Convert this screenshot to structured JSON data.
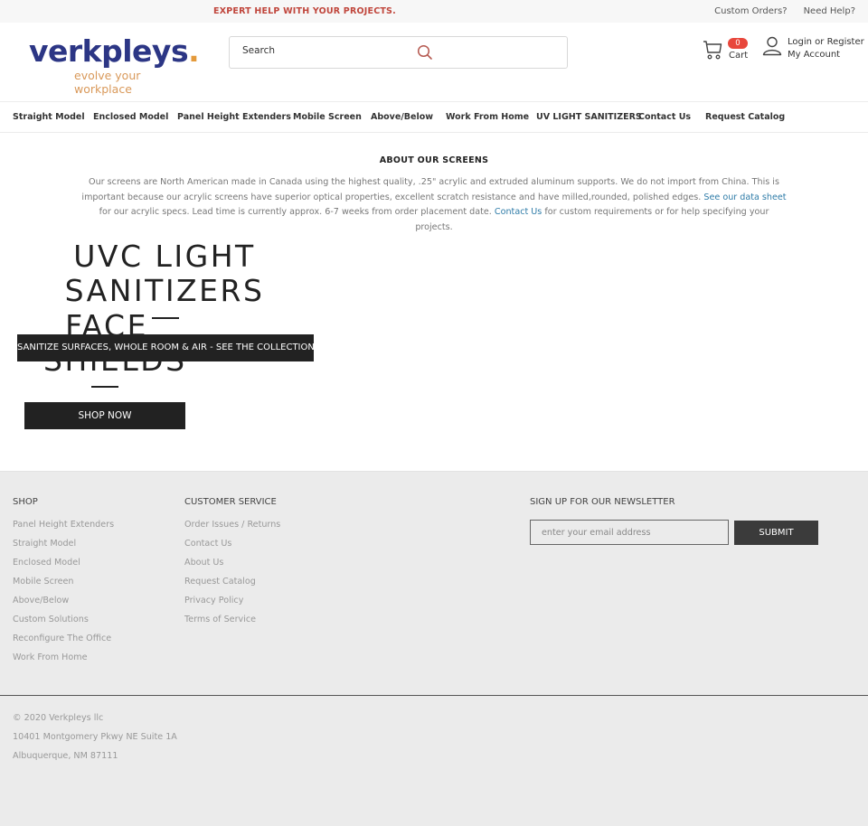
{
  "topbar": {
    "promo": "EXPERT HELP WITH YOUR PROJECTS.",
    "links": [
      "Custom Orders?",
      "Need Help?"
    ]
  },
  "header": {
    "logo": {
      "brand": "verkpleys",
      "dot": ".",
      "tagline": "evolve your workplace"
    },
    "search": {
      "placeholder": "Search",
      "value": "",
      "icon": "search-icon"
    },
    "cart": {
      "count": "0",
      "label": "Cart",
      "icon": "cart-icon"
    },
    "account": {
      "login": "Login or Register",
      "my_account": "My Account",
      "icon": "user-icon"
    }
  },
  "nav": {
    "items": [
      "Straight Model",
      "Enclosed Model",
      "Panel Height Extenders",
      "Mobile Screen",
      "Above/Below",
      "Work From Home",
      "UV LIGHT SANITIZERS",
      "Contact Us",
      "Request Catalog"
    ]
  },
  "about": {
    "title": "ABOUT OUR SCREENS",
    "text_1": "Our screens are North American made in Canada using the highest quality, .25\" acrylic and extruded aluminum supports. We do not import from China. This is important because our acrylic screens have superior optical properties, excellent scratch resistance and have milled,rounded, polished edges. ",
    "link_1": "See our data sheet",
    "text_2": " for our acrylic specs. Lead time is currently approx. 6-7 weeks from order placement date. ",
    "link_2": "Contact Us",
    "text_3": " for custom requirements or for help specifying your projects."
  },
  "hero": {
    "heading_1": "UVC LIGHT SANITIZERS",
    "heading_2": "FACE SHIELDS",
    "banner": "SANITIZE SURFACES, WHOLE ROOM & AIR - SEE THE COLLECTION",
    "cta": "SHOP NOW"
  },
  "footer": {
    "shop": {
      "title": "SHOP",
      "links": [
        "Panel Height Extenders",
        "Straight Model",
        "Enclosed Model",
        "Mobile Screen",
        "Above/Below",
        "Custom Solutions",
        "Reconfigure The Office",
        "Work From Home"
      ]
    },
    "customer_service": {
      "title": "CUSTOMER SERVICE",
      "links": [
        "Order Issues / Returns",
        "Contact Us",
        "About Us",
        "Request Catalog",
        "Privacy Policy",
        "Terms of Service"
      ]
    },
    "newsletter": {
      "title": "SIGN UP FOR OUR NEWSLETTER",
      "placeholder": "enter your email address",
      "value": "",
      "submit": "SUBMIT"
    },
    "bottom": [
      "© 2020 Verkpleys llc",
      "10401 Montgomery Pkwy NE Suite 1A",
      "Albuquerque, NM 87111"
    ]
  },
  "colors": {
    "brand_blue": "#2c3685",
    "brand_orange": "#e49a3b",
    "promo_red": "#c0463c",
    "badge_red": "#e8473c",
    "link_blue": "#2f7ca8",
    "dark_button": "#222222"
  }
}
